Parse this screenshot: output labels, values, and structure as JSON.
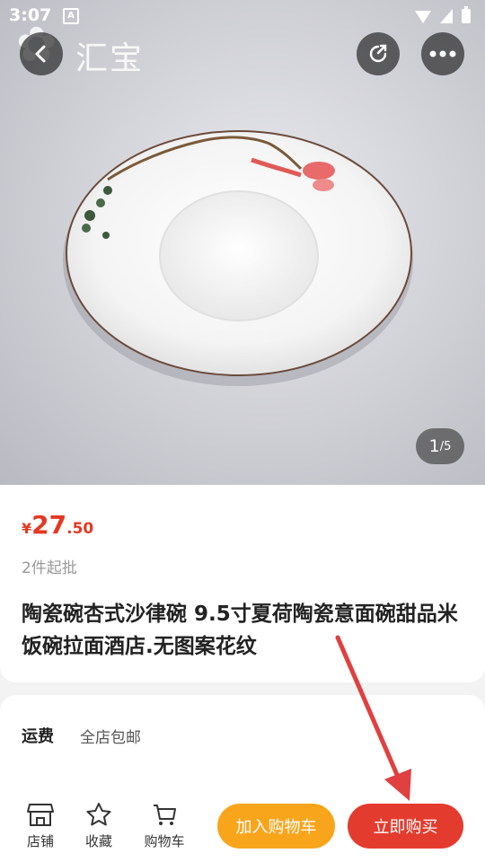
{
  "status_bar": {
    "time": "3:07",
    "notification_icon": "A"
  },
  "header": {
    "brand": "汇宝",
    "back_icon": "chevron-left-icon",
    "share_icon": "share-icon",
    "more_icon": "more-icon"
  },
  "gallery": {
    "current": "1",
    "total": "/5"
  },
  "product": {
    "currency": "¥",
    "price_int": "27",
    "price_dec": ".50",
    "moq": "2件起批",
    "title": "陶瓷碗杏式沙律碗 9.5寸夏荷陶瓷意面碗甜品米饭碗拉面酒店.无图案花纹"
  },
  "shipping": {
    "label": "运费",
    "value": "全店包邮"
  },
  "bottom_bar": {
    "store": "店铺",
    "favorite": "收藏",
    "cart": "购物车",
    "add_to_cart": "加入购物车",
    "buy_now": "立即购买"
  },
  "colors": {
    "price": "#e5381f",
    "add_to_cart": "#f8a51c",
    "buy_now": "#e33b2e",
    "annotation_arrow": "#e04040"
  }
}
